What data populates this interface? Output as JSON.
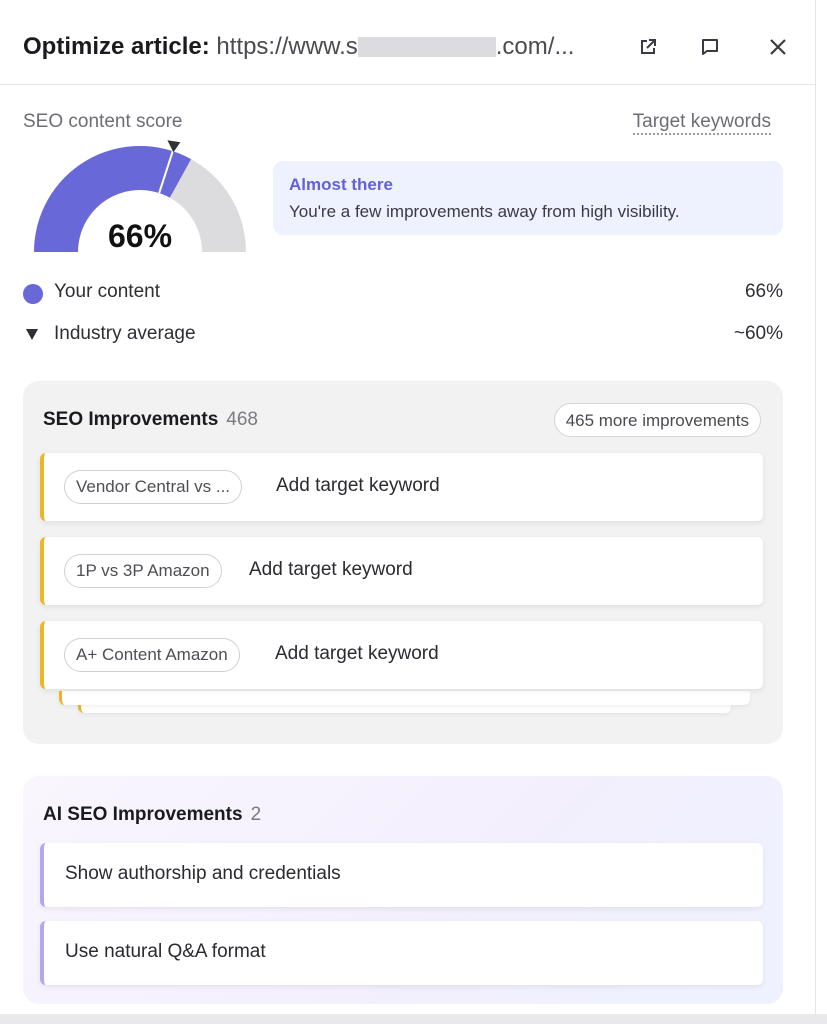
{
  "header": {
    "title_bold": "Optimize article:",
    "url_prefix": "https://www.s",
    "url_suffix": ".com/...",
    "icons": [
      "external-link-icon",
      "comment-icon",
      "close-icon"
    ]
  },
  "score": {
    "label": "SEO content score",
    "target_link": "Target keywords",
    "value": 66,
    "value_text": "66%",
    "industry_average": 60,
    "status_title": "Almost there",
    "status_desc": "You're a few improvements away from high visibility.",
    "legend": [
      {
        "label": "Your content",
        "value": "66%"
      },
      {
        "label": "Industry average",
        "value": "~60%"
      }
    ],
    "colors": {
      "fill": "#6868d8",
      "track": "#dcdcde",
      "status": "#6460d6"
    }
  },
  "seo": {
    "title": "SEO Improvements",
    "count": "468",
    "more": "465 more improvements",
    "items": [
      {
        "chip": "Vendor Central vs ...",
        "action": "Add target keyword"
      },
      {
        "chip": "1P vs 3P Amazon",
        "action": "Add target keyword"
      },
      {
        "chip": "A+ Content Amazon",
        "action": "Add target keyword"
      }
    ],
    "accent": "#f0b429"
  },
  "ai": {
    "title": "AI SEO Improvements",
    "count": "2",
    "items": [
      {
        "text": "Show authorship and credentials"
      },
      {
        "text": "Use natural Q&A format"
      }
    ],
    "accent": "#b5a6ee"
  }
}
